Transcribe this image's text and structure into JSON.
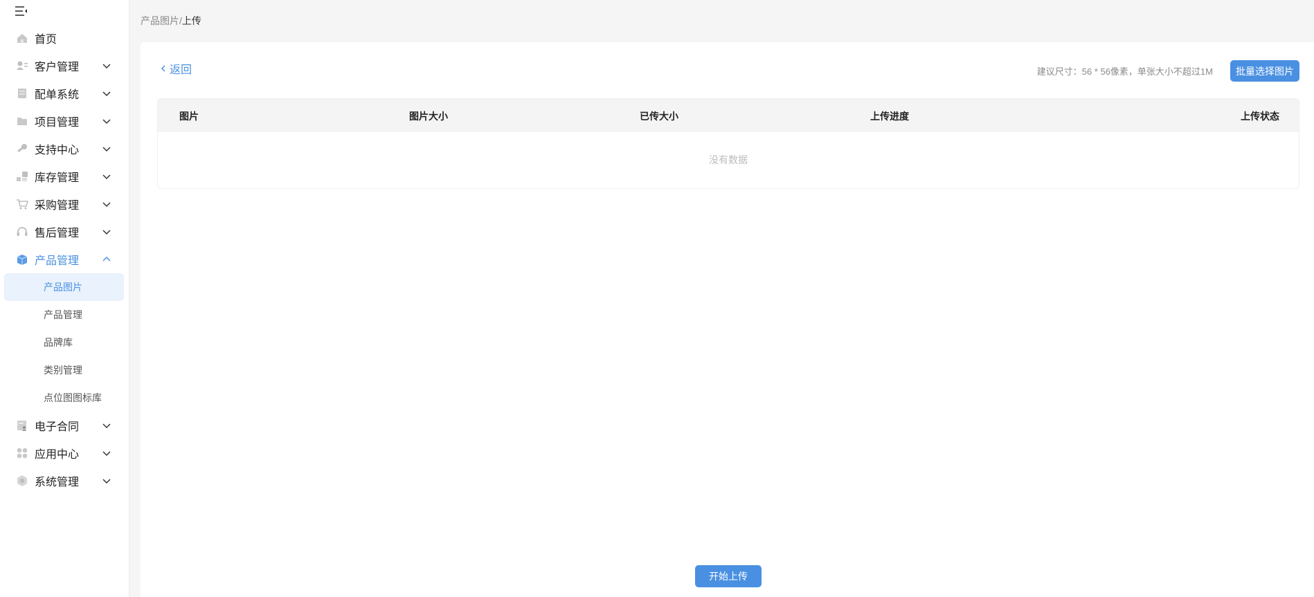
{
  "sidebar": {
    "collapse_icon": "menu-fold-icon",
    "items": [
      {
        "label": "首页",
        "icon": "home-icon"
      },
      {
        "label": "客户管理",
        "icon": "customer-icon"
      },
      {
        "label": "配单系统",
        "icon": "order-icon"
      },
      {
        "label": "项目管理",
        "icon": "folder-icon"
      },
      {
        "label": "支持中心",
        "icon": "wrench-icon"
      },
      {
        "label": "库存管理",
        "icon": "inventory-icon"
      },
      {
        "label": "采购管理",
        "icon": "cart-icon"
      },
      {
        "label": "售后管理",
        "icon": "headset-icon"
      },
      {
        "label": "产品管理",
        "icon": "box-icon",
        "expanded": true
      },
      {
        "label": "电子合同",
        "icon": "contract-icon"
      },
      {
        "label": "应用中心",
        "icon": "apps-icon"
      },
      {
        "label": "系统管理",
        "icon": "settings-icon"
      }
    ],
    "product_sub": [
      {
        "label": "产品图片",
        "active": true
      },
      {
        "label": "产品管理"
      },
      {
        "label": "品牌库"
      },
      {
        "label": "类别管理"
      },
      {
        "label": "点位图图标库"
      }
    ]
  },
  "breadcrumb": {
    "parent": "产品图片",
    "separator": "/",
    "current": "上传"
  },
  "main": {
    "back_label": "返回",
    "hint": "建议尺寸：56 * 56像素，单张大小不超过1M",
    "batch_button": "批量选择图片",
    "table": {
      "columns": [
        "图片",
        "图片大小",
        "已传大小",
        "上传进度",
        "上传状态"
      ],
      "rows": [],
      "empty_text": "没有数据"
    },
    "start_button": "开始上传"
  },
  "colors": {
    "accent": "#4a90e2",
    "active_bg": "#e9f2fd",
    "page_bg": "#f5f5f5"
  }
}
